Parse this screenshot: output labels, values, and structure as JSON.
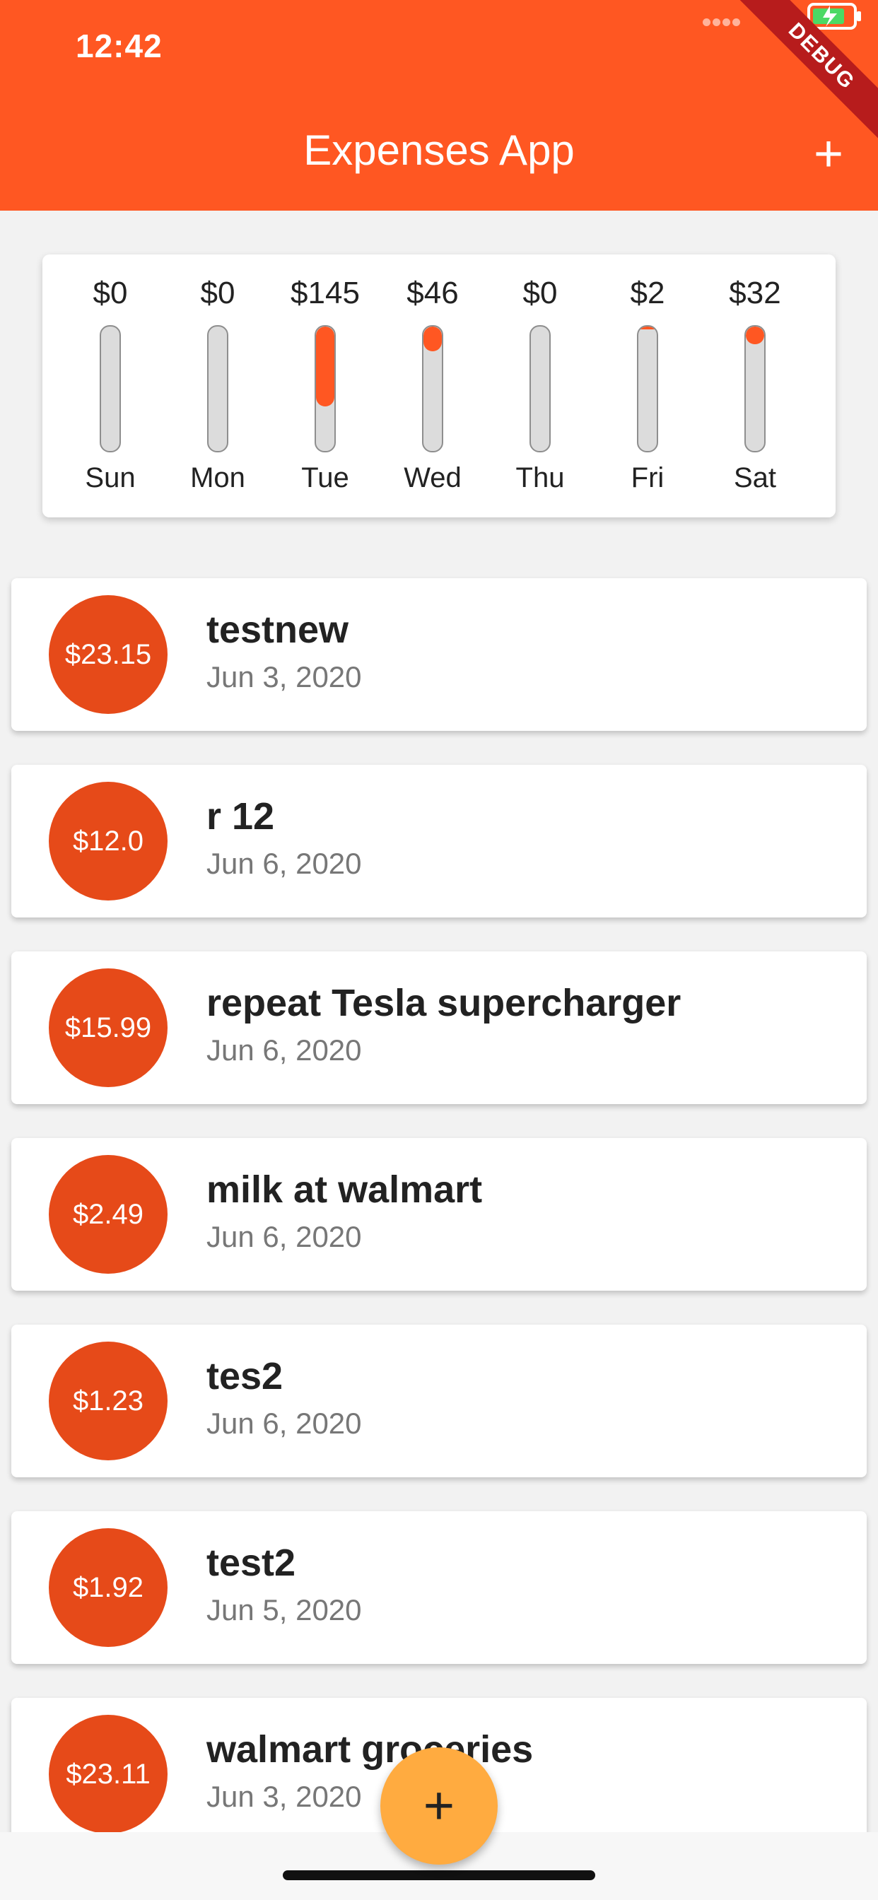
{
  "status_bar": {
    "time": "12:42",
    "icons": [
      "signal-dots-icon",
      "wifi-icon",
      "battery-charging-icon"
    ]
  },
  "app_bar": {
    "title": "Expenses App",
    "add_action": "+",
    "debug_banner": "DEBUG",
    "color": "#ff5722"
  },
  "chart": {
    "days": [
      {
        "amount": "$0",
        "day": "Sun",
        "fill_fraction": 0
      },
      {
        "amount": "$0",
        "day": "Mon",
        "fill_fraction": 0
      },
      {
        "amount": "$145",
        "day": "Tue",
        "fill_fraction": 0.64
      },
      {
        "amount": "$46",
        "day": "Wed",
        "fill_fraction": 0.2
      },
      {
        "amount": "$0",
        "day": "Thu",
        "fill_fraction": 0
      },
      {
        "amount": "$2",
        "day": "Fri",
        "fill_fraction": 0.01
      },
      {
        "amount": "$32",
        "day": "Sat",
        "fill_fraction": 0.14
      }
    ]
  },
  "transactions": [
    {
      "amount": "$23.15",
      "title": "testnew",
      "date": "Jun 3, 2020"
    },
    {
      "amount": "$12.0",
      "title": "r 12",
      "date": "Jun 6, 2020"
    },
    {
      "amount": "$15.99",
      "title": "repeat Tesla supercharger",
      "date": "Jun 6, 2020"
    },
    {
      "amount": "$2.49",
      "title": "milk at walmart",
      "date": "Jun 6, 2020"
    },
    {
      "amount": "$1.23",
      "title": "tes2",
      "date": "Jun 6, 2020"
    },
    {
      "amount": "$1.92",
      "title": "test2",
      "date": "Jun 5, 2020"
    },
    {
      "amount": "$23.11",
      "title": "walmart groceries",
      "date": "Jun 3, 2020"
    }
  ],
  "fab": {
    "label": "+",
    "color": "#ffab40"
  },
  "accent_colors": {
    "avatar": "#e64a19",
    "bar_fill": "#ff5722"
  }
}
